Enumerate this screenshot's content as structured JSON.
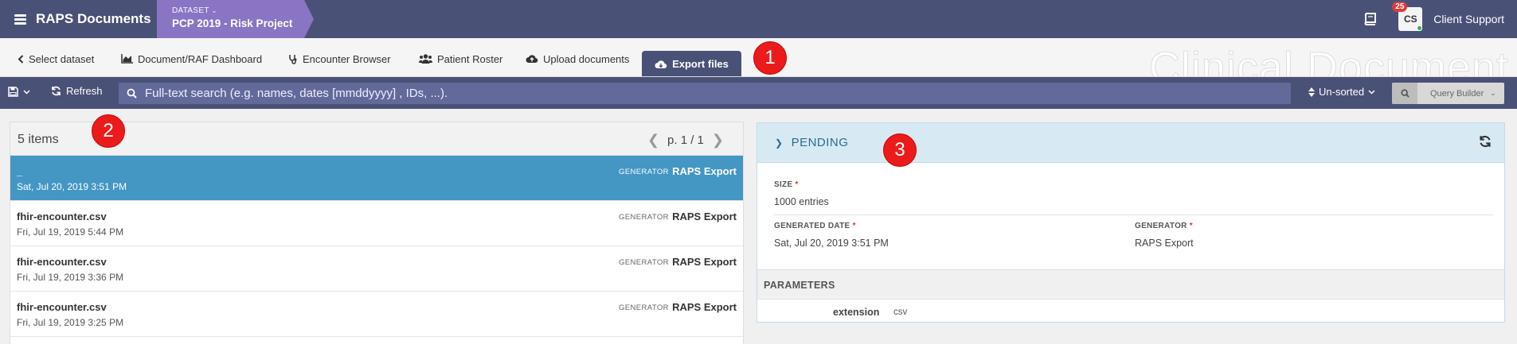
{
  "app": {
    "title": "RAPS Documents",
    "dataset_label": "DATASET",
    "dataset_name": "PCP 2019 - Risk Project",
    "notification_count": "25",
    "user_initials": "CS",
    "user_name": "Client Support"
  },
  "tabs": [
    {
      "label": "Select dataset",
      "icon": "chevron-left-icon"
    },
    {
      "label": "Document/RAF Dashboard",
      "icon": "area-chart-icon"
    },
    {
      "label": "Encounter Browser",
      "icon": "stethoscope-icon"
    },
    {
      "label": "Patient Roster",
      "icon": "users-icon"
    },
    {
      "label": "Upload documents",
      "icon": "cloud-upload-icon"
    },
    {
      "label": "Export files",
      "icon": "cloud-download-icon",
      "active": true
    }
  ],
  "watermark": "Clinical Document",
  "markers": [
    "1",
    "2",
    "3"
  ],
  "toolbar": {
    "refresh_label": "Refresh",
    "search_placeholder": "Full-text search (e.g. names, dates [mmddyyyy] , IDs, ...).",
    "sort_label": "Un-sorted",
    "query_builder_label": "Query Builder"
  },
  "list": {
    "count_label": "5 items",
    "page_label": "p. 1 / 1",
    "generator_label": "GENERATOR",
    "items": [
      {
        "name": "_",
        "date": "Sat, Jul 20, 2019 3:51 PM",
        "generator": "RAPS Export",
        "selected": true
      },
      {
        "name": "fhir-encounter.csv",
        "date": "Fri, Jul 19, 2019 5:44 PM",
        "generator": "RAPS Export"
      },
      {
        "name": "fhir-encounter.csv",
        "date": "Fri, Jul 19, 2019 3:36 PM",
        "generator": "RAPS Export"
      },
      {
        "name": "fhir-encounter.csv",
        "date": "Fri, Jul 19, 2019 3:25 PM",
        "generator": "RAPS Export"
      }
    ]
  },
  "detail": {
    "status": "PENDING",
    "size_label": "SIZE",
    "size_value": "1000 entries",
    "generated_date_label": "GENERATED DATE",
    "generated_date_value": "Sat, Jul 20, 2019 3:51 PM",
    "generator_label": "GENERATOR",
    "generator_value": "RAPS Export",
    "parameters_label": "PARAMETERS",
    "param_key": "extension",
    "param_value": "csv"
  },
  "colors": {
    "nav": "#4a5177",
    "dataset": "#8a74c4",
    "selected_row": "#4496c3",
    "marker": "#ec1b1b"
  }
}
